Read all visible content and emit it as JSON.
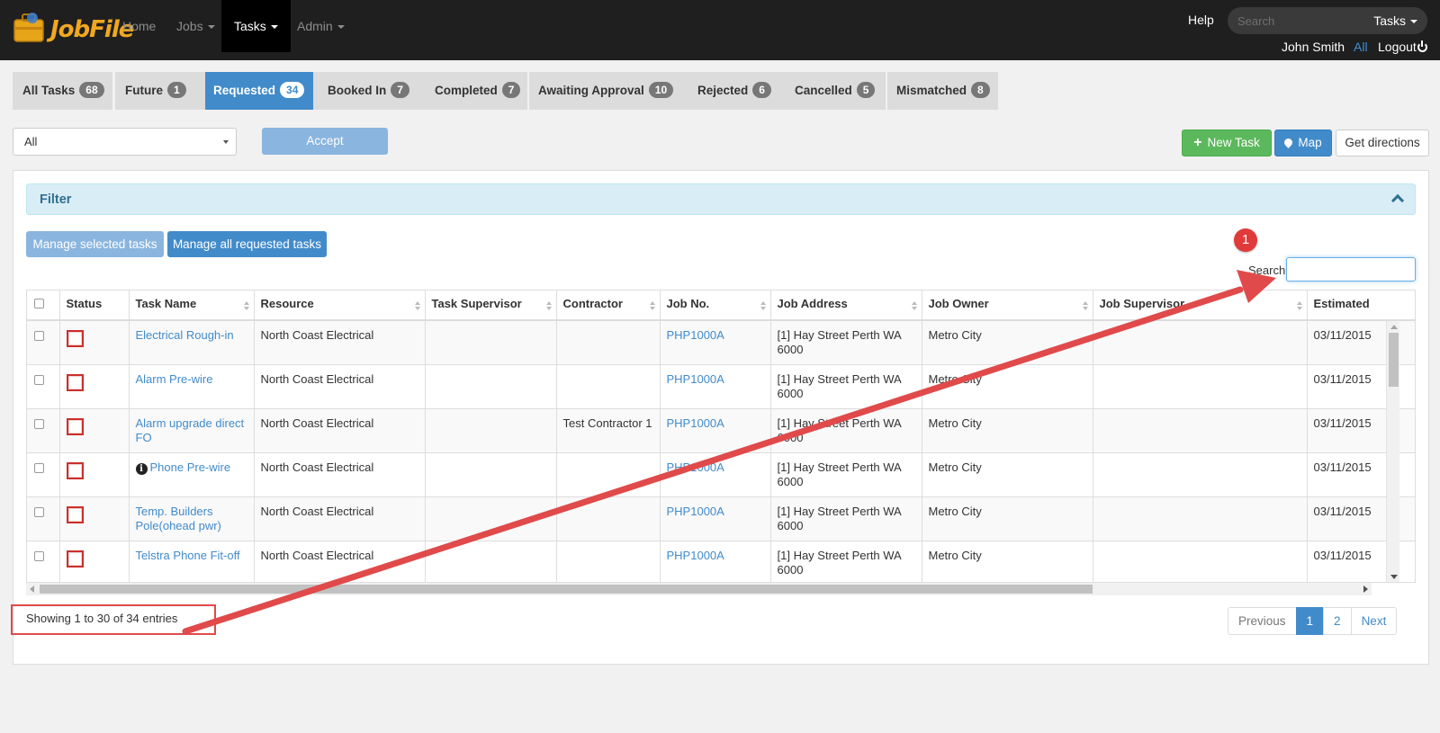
{
  "navbar": {
    "logo_text": "JobFile",
    "items": [
      {
        "label": "Home"
      },
      {
        "label": "Jobs"
      },
      {
        "label": "Tasks"
      },
      {
        "label": "Admin"
      }
    ],
    "help": "Help",
    "search_placeholder": "Search",
    "search_scope": "Tasks",
    "user": "John Smith",
    "all": "All",
    "logout": "Logout"
  },
  "status_tabs": [
    {
      "label": "All Tasks",
      "count": "68"
    },
    {
      "label": "Future",
      "count": "1"
    },
    {
      "label": "Requested",
      "count": "34",
      "active": true
    },
    {
      "label": "Booked In",
      "count": "7"
    },
    {
      "label": "Completed",
      "count": "7"
    },
    {
      "label": "Awaiting Approval",
      "count": "10"
    },
    {
      "label": "Rejected",
      "count": "6"
    },
    {
      "label": "Cancelled",
      "count": "5"
    },
    {
      "label": "Mismatched",
      "count": "8"
    }
  ],
  "toolbar": {
    "bulk_select_value": "All",
    "accept_label": "Accept",
    "new_task_label": "New Task",
    "map_label": "Map",
    "directions_label": "Get directions"
  },
  "panel": {
    "filter_title": "Filter",
    "manage_selected_label": "Manage selected tasks",
    "manage_all_label": "Manage all requested tasks",
    "search_label": "Search:"
  },
  "table": {
    "columns": [
      "Status",
      "Task Name",
      "Resource",
      "Task Supervisor",
      "Contractor",
      "Job No.",
      "Job Address",
      "Job Owner",
      "Job Supervisor",
      "Estimated"
    ],
    "rows": [
      {
        "task": "Electrical Rough-in",
        "resource": "North Coast Electrical",
        "supervisor": "",
        "contractor": "",
        "job_no": "PHP1000A",
        "address": "[1] Hay Street Perth WA 6000",
        "owner": "Metro City",
        "job_supervisor": "",
        "estimated": "03/11/2015"
      },
      {
        "task": "Alarm Pre-wire",
        "resource": "North Coast Electrical",
        "supervisor": "",
        "contractor": "",
        "job_no": "PHP1000A",
        "address": "[1] Hay Street Perth WA 6000",
        "owner": "Metro City",
        "job_supervisor": "",
        "estimated": "03/11/2015"
      },
      {
        "task": "Alarm upgrade direct FO",
        "resource": "North Coast Electrical",
        "supervisor": "",
        "contractor": "Test Contractor 1",
        "job_no": "PHP1000A",
        "address": "[1] Hay Street Perth WA 6000",
        "owner": "Metro City",
        "job_supervisor": "",
        "estimated": "03/11/2015"
      },
      {
        "task": "Phone Pre-wire",
        "resource": "North Coast Electrical",
        "supervisor": "",
        "contractor": "",
        "job_no": "PHP1000A",
        "address": "[1] Hay Street Perth WA 6000",
        "owner": "Metro City",
        "job_supervisor": "",
        "estimated": "03/11/2015"
      },
      {
        "task": "Temp. Builders Pole(ohead pwr)",
        "resource": "North Coast Electrical",
        "supervisor": "",
        "contractor": "",
        "job_no": "PHP1000A",
        "address": "[1] Hay Street Perth WA 6000",
        "owner": "Metro City",
        "job_supervisor": "",
        "estimated": "03/11/2015"
      },
      {
        "task": "Telstra Phone Fit-off",
        "resource": "North Coast Electrical",
        "supervisor": "",
        "contractor": "",
        "job_no": "PHP1000A",
        "address": "[1] Hay Street Perth WA 6000",
        "owner": "Metro City",
        "job_supervisor": "",
        "estimated": "03/11/2015"
      }
    ]
  },
  "footer": {
    "info": "Showing 1 to 30 of 34 entries",
    "pagination": {
      "previous": "Previous",
      "page1": "1",
      "page2": "2",
      "next": "Next"
    }
  },
  "annotation": {
    "badge": "1"
  },
  "colors": {
    "accent": "#428bca",
    "success": "#5cb85c",
    "annotation": "#e03a3a",
    "navbar": "#1f1f1f"
  }
}
